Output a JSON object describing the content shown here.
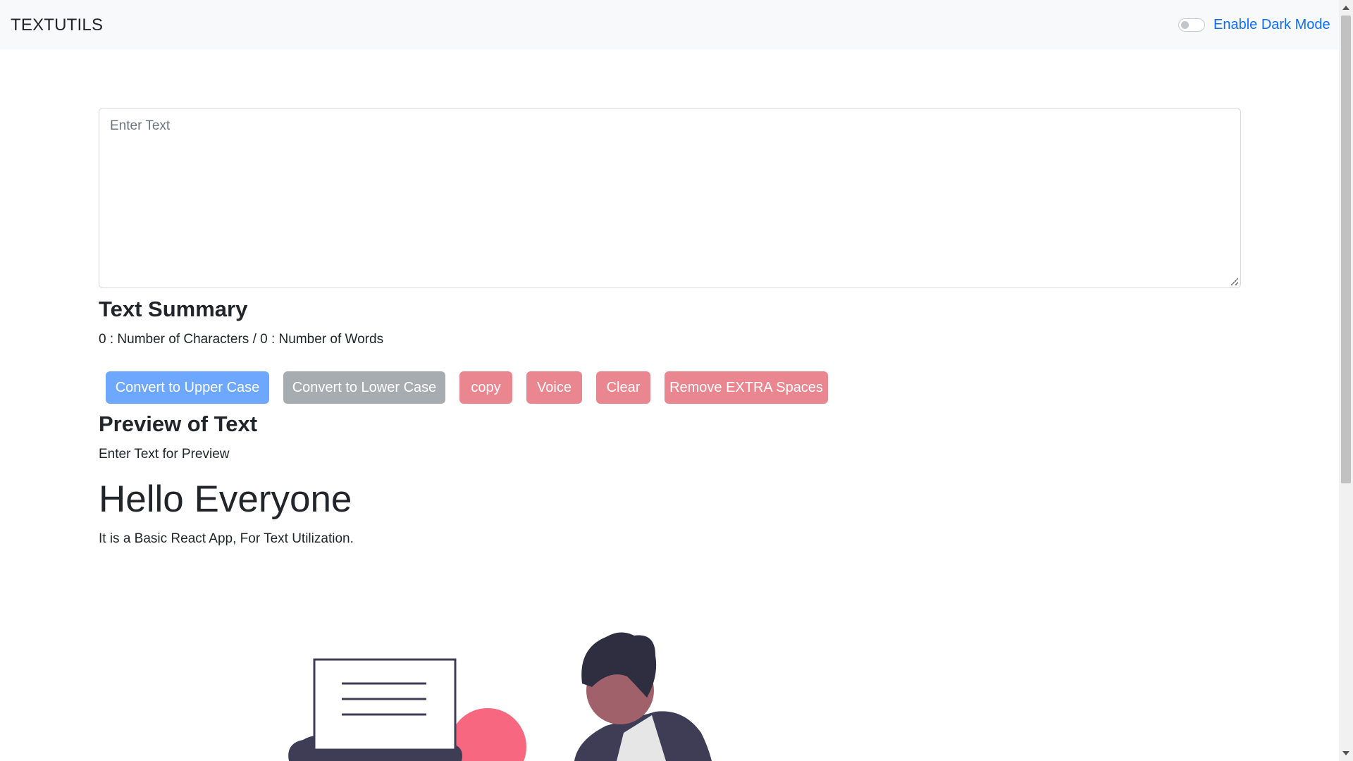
{
  "navbar": {
    "brand": "TEXTUTILS",
    "dark_mode_label": "Enable Dark Mode"
  },
  "editor": {
    "placeholder": "Enter Text",
    "value": ""
  },
  "summary": {
    "title": "Text Summary",
    "line": "0 : Number of Characters / 0 : Number of Words"
  },
  "buttons": {
    "upper": "Convert to Upper Case",
    "lower": "Convert to Lower Case",
    "copy": "copy",
    "voice": "Voice",
    "clear": "Clear",
    "remove_spaces": "Remove EXTRA Spaces"
  },
  "preview": {
    "title": "Preview of Text",
    "text": "Enter Text for Preview"
  },
  "hero": {
    "title": "Hello Everyone",
    "subtitle": "It is a Basic React App, For Text Utilization."
  },
  "colors": {
    "primary": "#6ea8fe",
    "secondary": "#a7acb1",
    "danger": "#ea868f",
    "link": "#0d6efd",
    "navbar_bg": "#f8f9fa"
  },
  "icons": {
    "toggle": "toggle-switch-icon",
    "resize": "resize-handle-icon"
  }
}
